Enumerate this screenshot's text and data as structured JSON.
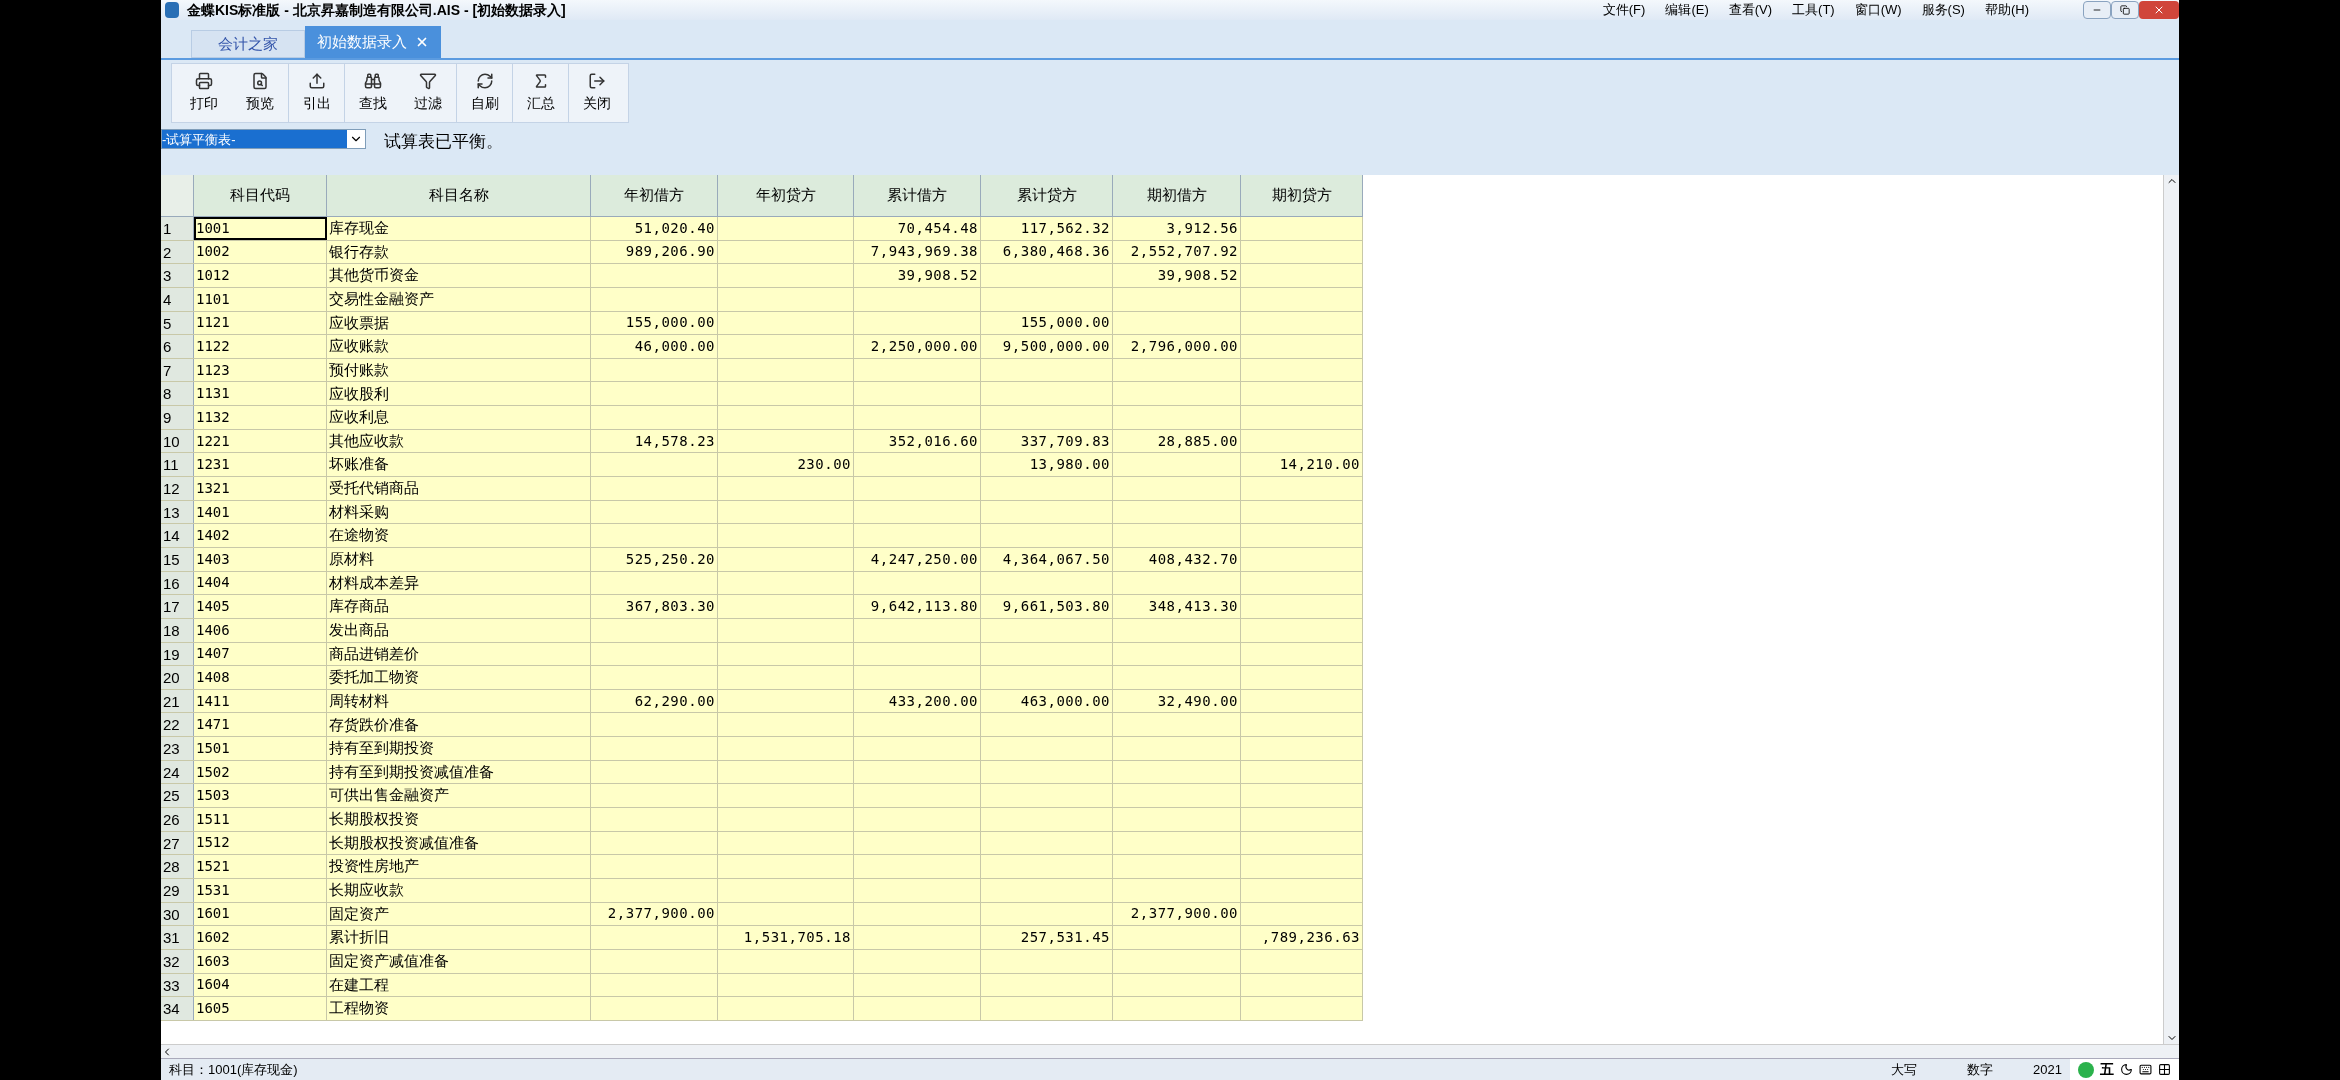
{
  "window": {
    "title": "金蝶KIS标准版 - 北京昇嘉制造有限公司.AIS - [初始数据录入]"
  },
  "menu": [
    "文件(F)",
    "编辑(E)",
    "查看(V)",
    "工具(T)",
    "窗口(W)",
    "服务(S)",
    "帮助(H)"
  ],
  "tabs": [
    {
      "label": "会计之家",
      "selected": false
    },
    {
      "label": "初始数据录入",
      "selected": true
    }
  ],
  "toolbar": [
    "打印",
    "预览",
    "引出",
    "查找",
    "过滤",
    "自刷",
    "汇总",
    "关闭"
  ],
  "report_select": {
    "value": "-试算平衡表-"
  },
  "message": "试算表已平衡。",
  "table": {
    "columns": [
      "科目代码",
      "科目名称",
      "年初借方",
      "年初贷方",
      "累计借方",
      "累计贷方",
      "期初借方",
      "期初贷方"
    ],
    "rows": [
      {
        "no": "1",
        "cells": [
          "1001",
          "库存现金",
          "51,020.40",
          null,
          "70,454.48",
          "117,562.32",
          "3,912.56",
          null
        ]
      },
      {
        "no": "2",
        "cells": [
          "1002",
          "银行存款",
          "989,206.90",
          null,
          "7,943,969.38",
          "6,380,468.36",
          "2,552,707.92",
          null
        ]
      },
      {
        "no": "3",
        "cells": [
          "1012",
          "其他货币资金",
          null,
          null,
          "39,908.52",
          null,
          "39,908.52",
          null
        ]
      },
      {
        "no": "4",
        "cells": [
          "1101",
          "交易性金融资产",
          null,
          null,
          null,
          null,
          null,
          null
        ]
      },
      {
        "no": "5",
        "cells": [
          "1121",
          "应收票据",
          "155,000.00",
          null,
          null,
          "155,000.00",
          null,
          null
        ]
      },
      {
        "no": "6",
        "cells": [
          "1122",
          "应收账款",
          "46,000.00",
          null,
          "2,250,000.00",
          "9,500,000.00",
          "2,796,000.00",
          null
        ]
      },
      {
        "no": "7",
        "cells": [
          "1123",
          "预付账款",
          null,
          null,
          null,
          null,
          null,
          null
        ]
      },
      {
        "no": "8",
        "cells": [
          "1131",
          "应收股利",
          null,
          null,
          null,
          null,
          null,
          null
        ]
      },
      {
        "no": "9",
        "cells": [
          "1132",
          "应收利息",
          null,
          null,
          null,
          null,
          null,
          null
        ]
      },
      {
        "no": "10",
        "cells": [
          "1221",
          "其他应收款",
          "14,578.23",
          null,
          "352,016.60",
          "337,709.83",
          "28,885.00",
          null
        ]
      },
      {
        "no": "11",
        "cells": [
          "1231",
          "坏账准备",
          null,
          "230.00",
          null,
          "13,980.00",
          null,
          "14,210.00"
        ]
      },
      {
        "no": "12",
        "cells": [
          "1321",
          "受托代销商品",
          null,
          null,
          null,
          null,
          null,
          null
        ]
      },
      {
        "no": "13",
        "cells": [
          "1401",
          "材料采购",
          null,
          null,
          null,
          null,
          null,
          null
        ]
      },
      {
        "no": "14",
        "cells": [
          "1402",
          "在途物资",
          null,
          null,
          null,
          null,
          null,
          null
        ]
      },
      {
        "no": "15",
        "cells": [
          "1403",
          "原材料",
          "525,250.20",
          null,
          "4,247,250.00",
          "4,364,067.50",
          "408,432.70",
          null
        ]
      },
      {
        "no": "16",
        "cells": [
          "1404",
          "材料成本差异",
          null,
          null,
          null,
          null,
          null,
          null
        ]
      },
      {
        "no": "17",
        "cells": [
          "1405",
          "库存商品",
          "367,803.30",
          null,
          "9,642,113.80",
          "9,661,503.80",
          "348,413.30",
          null
        ]
      },
      {
        "no": "18",
        "cells": [
          "1406",
          "发出商品",
          null,
          null,
          null,
          null,
          null,
          null
        ]
      },
      {
        "no": "19",
        "cells": [
          "1407",
          "商品进销差价",
          null,
          null,
          null,
          null,
          null,
          null
        ]
      },
      {
        "no": "20",
        "cells": [
          "1408",
          "委托加工物资",
          null,
          null,
          null,
          null,
          null,
          null
        ]
      },
      {
        "no": "21",
        "cells": [
          "1411",
          "周转材料",
          "62,290.00",
          null,
          "433,200.00",
          "463,000.00",
          "32,490.00",
          null
        ]
      },
      {
        "no": "22",
        "cells": [
          "1471",
          "存货跌价准备",
          null,
          null,
          null,
          null,
          null,
          null
        ]
      },
      {
        "no": "23",
        "cells": [
          "1501",
          "持有至到期投资",
          null,
          null,
          null,
          null,
          null,
          null
        ]
      },
      {
        "no": "24",
        "cells": [
          "1502",
          "持有至到期投资减值准备",
          null,
          null,
          null,
          null,
          null,
          null
        ]
      },
      {
        "no": "25",
        "cells": [
          "1503",
          "可供出售金融资产",
          null,
          null,
          null,
          null,
          null,
          null
        ]
      },
      {
        "no": "26",
        "cells": [
          "1511",
          "长期股权投资",
          null,
          null,
          null,
          null,
          null,
          null
        ]
      },
      {
        "no": "27",
        "cells": [
          "1512",
          "长期股权投资减值准备",
          null,
          null,
          null,
          null,
          null,
          null
        ]
      },
      {
        "no": "28",
        "cells": [
          "1521",
          "投资性房地产",
          null,
          null,
          null,
          null,
          null,
          null
        ]
      },
      {
        "no": "29",
        "cells": [
          "1531",
          "长期应收款",
          null,
          null,
          null,
          null,
          null,
          null
        ]
      },
      {
        "no": "30",
        "cells": [
          "1601",
          "固定资产",
          "2,377,900.00",
          null,
          null,
          null,
          "2,377,900.00",
          null
        ]
      },
      {
        "no": "31",
        "cells": [
          "1602",
          "累计折旧",
          null,
          "1,531,705.18",
          null,
          "257,531.45",
          null,
          ",789,236.63"
        ]
      },
      {
        "no": "32",
        "cells": [
          "1603",
          "固定资产减值准备",
          null,
          null,
          null,
          null,
          null,
          null
        ]
      },
      {
        "no": "33",
        "cells": [
          "1604",
          "在建工程",
          null,
          null,
          null,
          null,
          null,
          null
        ]
      },
      {
        "no": "34",
        "cells": [
          "1605",
          "工程物资",
          null,
          null,
          null,
          null,
          null,
          null
        ]
      }
    ]
  },
  "status_bar": {
    "account": "科目：1001(库存现金)",
    "caps": "大写",
    "num": "数字",
    "date": "2021"
  },
  "ime": {
    "mode": "五"
  }
}
